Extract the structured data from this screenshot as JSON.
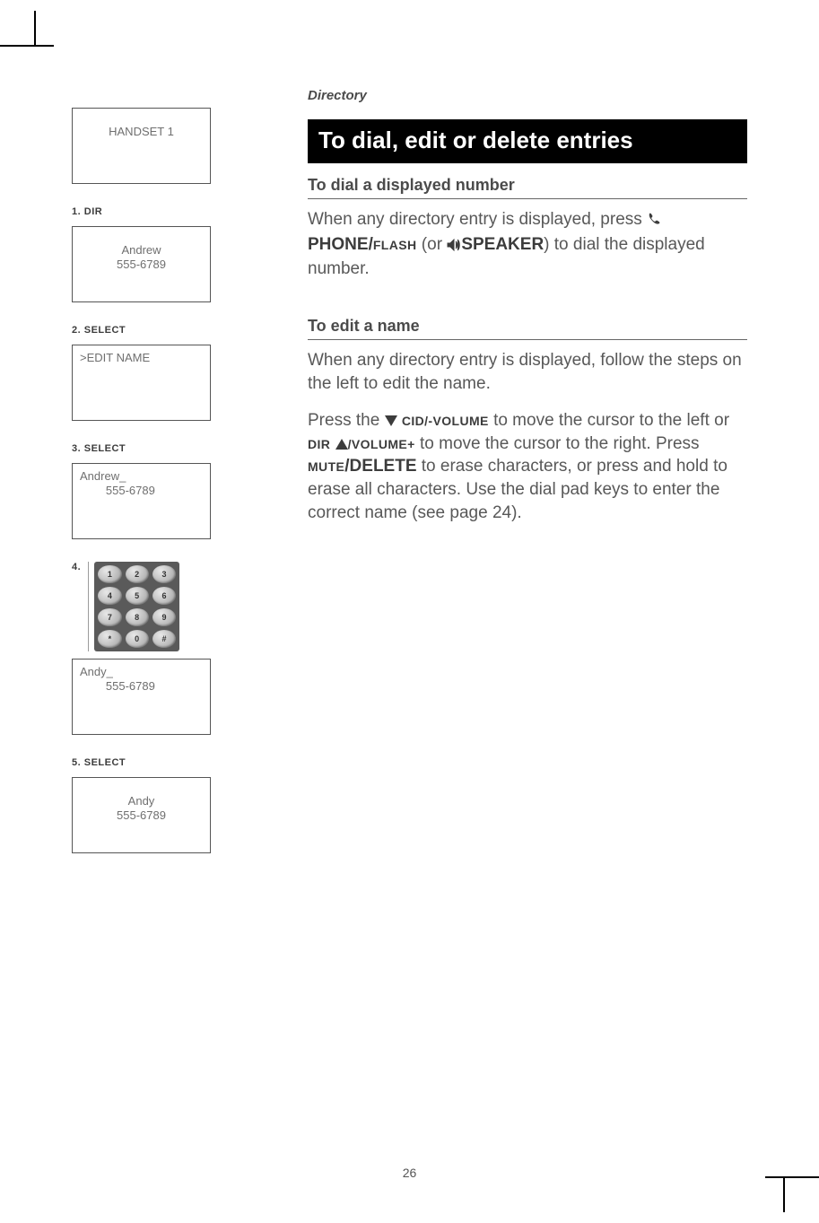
{
  "page_number": "26",
  "eyebrow": "Directory",
  "title": "To dial, edit or delete entries",
  "sections": [
    {
      "heading": "To dial a displayed number",
      "body_pre": "When any directory entry is displayed, press ",
      "key_phone_flash_a": "PHONE/",
      "key_phone_flash_b": "FLASH",
      "between_or": " (or ",
      "key_speaker": "SPEAKER",
      "body_post": ") to dial the displayed number."
    },
    {
      "heading": "To edit a name",
      "para1": "When any directory entry is displayed, follow the steps on the left to edit the name.",
      "para2_a": "Press the ",
      "key_cid_vol": "CID/-VOLUME",
      "para2_b": " to move the cursor to the left or ",
      "key_dir": "DIR",
      "key_vol_plus": "/VOLUME+",
      "para2_c": " to move the cursor to the right. Press ",
      "key_mute": "MUTE",
      "key_delete": "/DELETE",
      "para2_d": " to erase characters, or press and hold to erase all characters. Use the dial pad keys to enter the correct name (see page 24)."
    }
  ],
  "steps": [
    {
      "label_index": "1.",
      "label_key": "DIR",
      "lcd_lines": [
        "HANDSET 1"
      ],
      "lcd_align": "center",
      "lcd_before": true
    },
    {
      "label_index": "",
      "label_key": "",
      "lcd_lines": [
        "Andrew",
        "555-6789"
      ],
      "lcd_align": "center"
    },
    {
      "label_index": "2.",
      "label_key": "SELECT",
      "lcd_lines": [
        ">EDIT NAME"
      ],
      "lcd_align": "left"
    },
    {
      "label_index": "3.",
      "label_key": "SELECT",
      "lcd_lines": [
        "Andrew_",
        "        555-6789"
      ],
      "lcd_align": "left"
    },
    {
      "label_index": "4.",
      "label_key": "",
      "keypad": true
    },
    {
      "label_index": "",
      "label_key": "",
      "lcd_lines": [
        "Andy_",
        "        555-6789"
      ],
      "lcd_align": "left"
    },
    {
      "label_index": "5.",
      "label_key": "SELECT",
      "lcd_lines": [
        "Andy",
        "555-6789"
      ],
      "lcd_align": "center"
    }
  ],
  "keypad_keys": [
    "1",
    "2",
    "3",
    "4",
    "5",
    "6",
    "7",
    "8",
    "9",
    "*",
    "0",
    "#"
  ]
}
